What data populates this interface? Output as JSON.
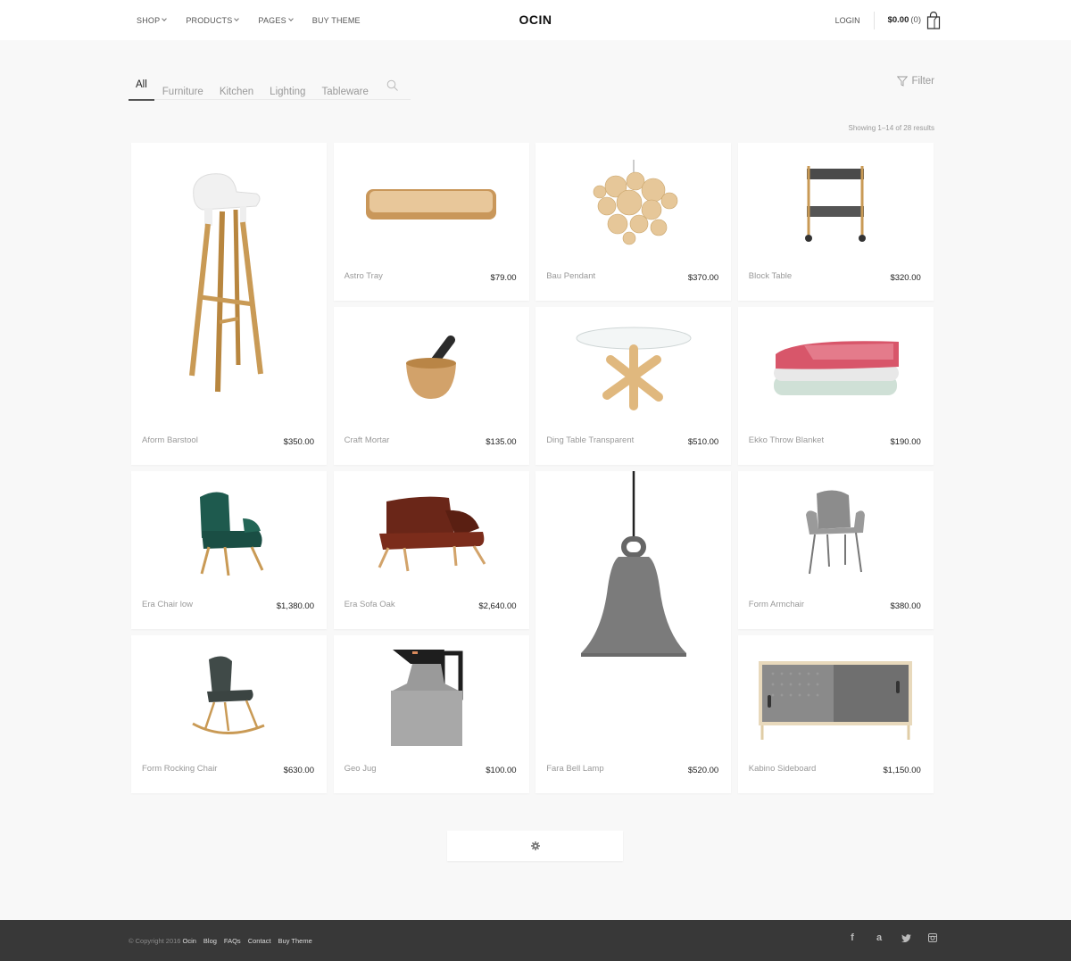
{
  "header": {
    "logo": "OCIN",
    "nav": [
      {
        "label": "SHOP",
        "dropdown": true
      },
      {
        "label": "PRODUCTS",
        "dropdown": true
      },
      {
        "label": "PAGES",
        "dropdown": true
      },
      {
        "label": "BUY THEME",
        "dropdown": false
      }
    ],
    "login_label": "LOGIN",
    "cart_total": "$0.00",
    "cart_count": "(0)",
    "cart_icon": "shopping-bag-icon"
  },
  "filters": {
    "tabs": [
      {
        "label": "All",
        "active": true
      },
      {
        "label": "Furniture",
        "active": false
      },
      {
        "label": "Kitchen",
        "active": false
      },
      {
        "label": "Lighting",
        "active": false
      },
      {
        "label": "Tableware",
        "active": false
      }
    ],
    "search_icon": "search-icon",
    "filter_label": "Filter",
    "filter_icon": "funnel-icon",
    "results_text": "Showing 1–14 of 28 results"
  },
  "products": [
    {
      "name": "Aform Barstool",
      "price": "$350.00",
      "image": "barstool"
    },
    {
      "name": "Astro Tray",
      "price": "$79.00",
      "image": "tray"
    },
    {
      "name": "Bau Pendant",
      "price": "$370.00",
      "image": "pendant"
    },
    {
      "name": "Block Table",
      "price": "$320.00",
      "image": "cart-table"
    },
    {
      "name": "Craft Mortar",
      "price": "$135.00",
      "image": "mortar"
    },
    {
      "name": "Ding Table Transparent",
      "price": "$510.00",
      "image": "glass-table"
    },
    {
      "name": "Ekko Throw Blanket",
      "price": "$190.00",
      "image": "blanket"
    },
    {
      "name": "Era Chair low",
      "price": "$1,380.00",
      "image": "green-chair"
    },
    {
      "name": "Era Sofa Oak",
      "price": "$2,640.00",
      "image": "sofa"
    },
    {
      "name": "Fara Bell Lamp",
      "price": "$520.00",
      "image": "bell-lamp"
    },
    {
      "name": "Form Armchair",
      "price": "$380.00",
      "image": "armchair"
    },
    {
      "name": "Form Rocking Chair",
      "price": "$630.00",
      "image": "rocking-chair"
    },
    {
      "name": "Geo Jug",
      "price": "$100.00",
      "image": "jug"
    },
    {
      "name": "Kabino Sideboard",
      "price": "$1,150.00",
      "image": "sideboard"
    }
  ],
  "load_more_icon": "gear-icon",
  "footer": {
    "copyright": "© Copyright 2016",
    "links": [
      "Ocin",
      "Blog",
      "FAQs",
      "Contact",
      "Buy Theme"
    ],
    "social": [
      "facebook-icon",
      "amazon-icon",
      "twitter-icon",
      "instagram-icon"
    ]
  }
}
